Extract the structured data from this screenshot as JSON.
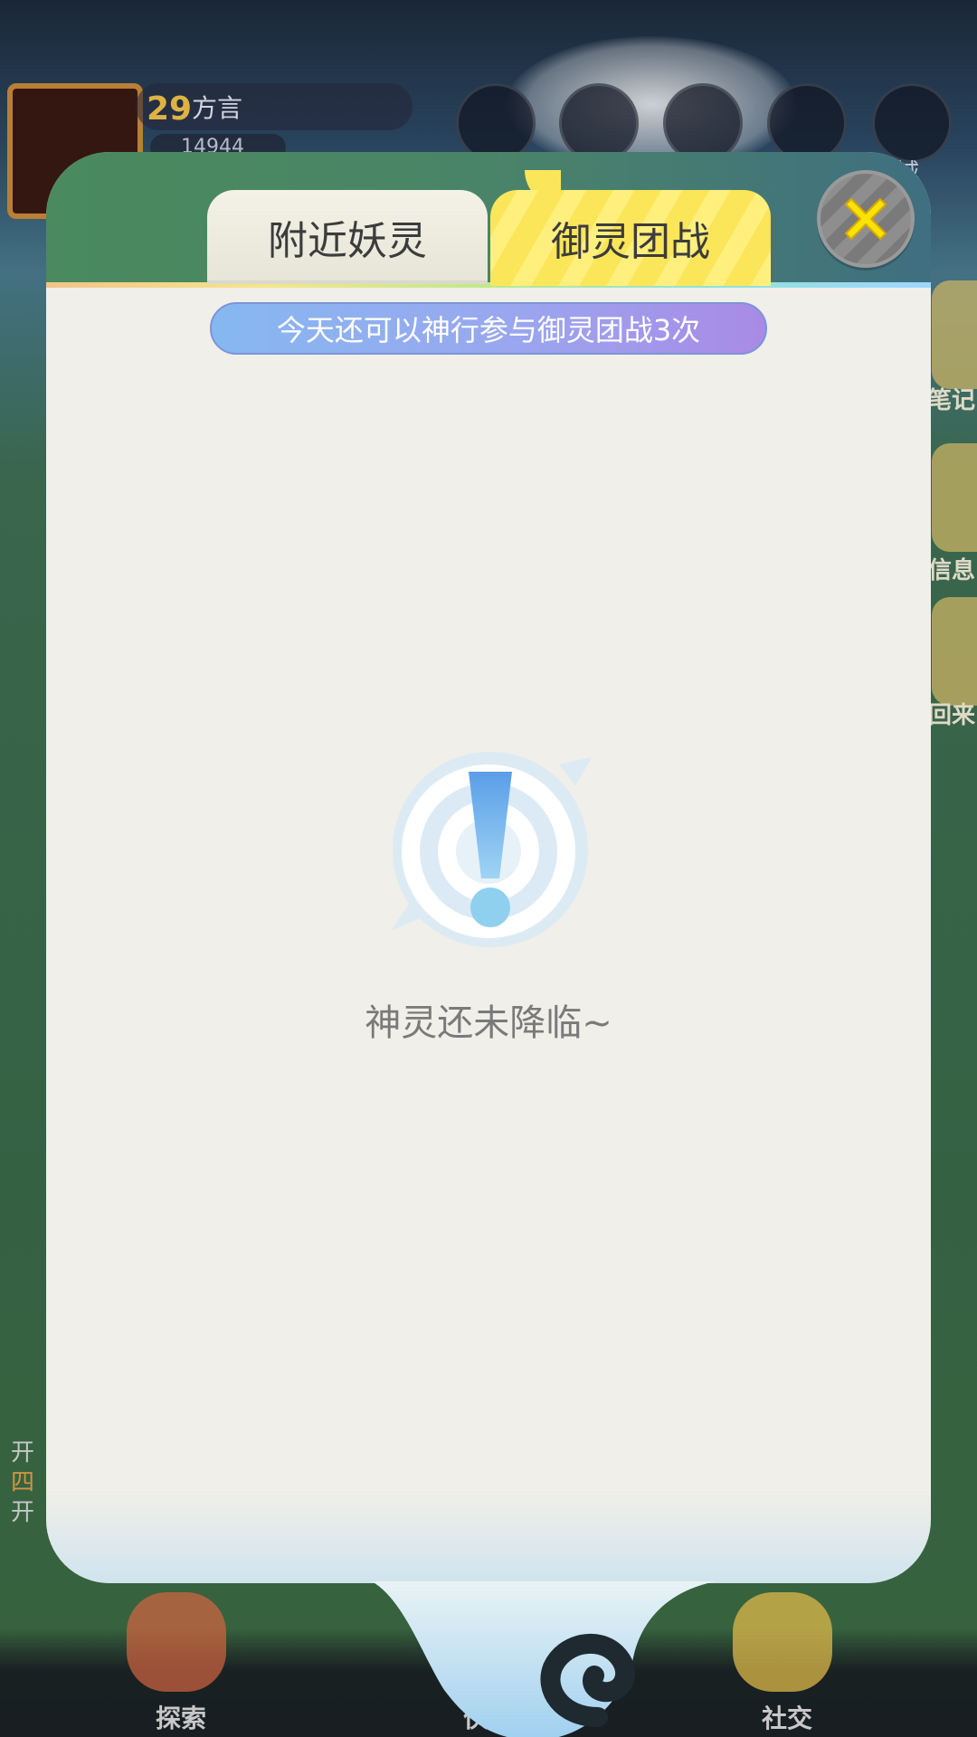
{
  "background": {
    "player_level": "29",
    "player_name": "方言",
    "coins": "14944",
    "top_right_label": "城",
    "side_labels": [
      "笔记",
      "信息",
      "回来"
    ],
    "left_texts": [
      "开",
      "四",
      "开"
    ],
    "bottom_nav": [
      "探索",
      "伙伴",
      "社交"
    ]
  },
  "dialog": {
    "tabs": [
      {
        "label": "附近妖灵",
        "selected": false
      },
      {
        "label": "御灵团战",
        "selected": true
      }
    ],
    "close_icon": "close-x-icon",
    "banner_text": "今天还可以神行参与御灵团战3次",
    "empty_icon": "exclamation-icon",
    "empty_message": "神灵还未降临~"
  },
  "colors": {
    "header_green": "#4a8a5e",
    "tab_selected_yellow": "#fbe65a",
    "close_x_yellow": "#f8e400",
    "banner_blue": "#86b8f0",
    "banner_purple": "#a98ae6",
    "panel_bg": "#f0efe9",
    "icon_blue": "#6fb4ec"
  }
}
